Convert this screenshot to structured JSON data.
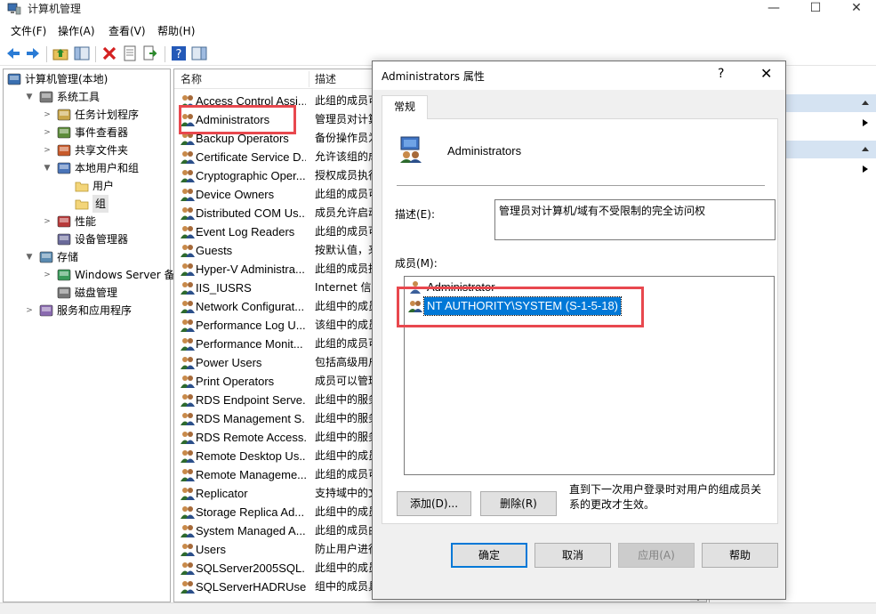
{
  "window": {
    "title": "计算机管理",
    "min": "—",
    "max": "☐",
    "close": "✕"
  },
  "menu": [
    {
      "label": "文件(F)"
    },
    {
      "label": "操作(A)"
    },
    {
      "label": "查看(V)"
    },
    {
      "label": "帮助(H)"
    }
  ],
  "tree": [
    {
      "label": "计算机管理(本地)",
      "expander": "",
      "icon": "computer-management-icon",
      "level": 0
    },
    {
      "label": "系统工具",
      "expander": "▼",
      "icon": "system-tools-icon",
      "level": 1
    },
    {
      "label": "任务计划程序",
      "expander": ">",
      "icon": "task-scheduler-icon",
      "level": 2
    },
    {
      "label": "事件查看器",
      "expander": ">",
      "icon": "event-viewer-icon",
      "level": 2
    },
    {
      "label": "共享文件夹",
      "expander": ">",
      "icon": "shared-folders-icon",
      "level": 2
    },
    {
      "label": "本地用户和组",
      "expander": "▼",
      "icon": "local-users-groups-icon",
      "level": 2
    },
    {
      "label": "用户",
      "expander": "",
      "icon": "folder-icon",
      "level": 3
    },
    {
      "label": "组",
      "expander": "",
      "icon": "folder-icon",
      "level": 3,
      "selected": true
    },
    {
      "label": "性能",
      "expander": ">",
      "icon": "performance-icon",
      "level": 2
    },
    {
      "label": "设备管理器",
      "expander": "",
      "icon": "device-manager-icon",
      "level": 2
    },
    {
      "label": "存储",
      "expander": "▼",
      "icon": "storage-icon",
      "level": 1
    },
    {
      "label": "Windows Server 备份",
      "expander": ">",
      "icon": "windows-backup-icon",
      "level": 2
    },
    {
      "label": "磁盘管理",
      "expander": "",
      "icon": "disk-management-icon",
      "level": 2
    },
    {
      "label": "服务和应用程序",
      "expander": ">",
      "icon": "services-apps-icon",
      "level": 1
    }
  ],
  "list": {
    "columns": {
      "name": "名称",
      "description": "描述"
    },
    "rows": [
      {
        "name": "Access Control Assi...",
        "description": "此组的成员可"
      },
      {
        "name": "Administrators",
        "description": "管理员对计算"
      },
      {
        "name": "Backup Operators",
        "description": "备份操作员为"
      },
      {
        "name": "Certificate Service D...",
        "description": "允许该组的成"
      },
      {
        "name": "Cryptographic Oper...",
        "description": "授权成员执行"
      },
      {
        "name": "Device Owners",
        "description": "此组的成员可"
      },
      {
        "name": "Distributed COM Us...",
        "description": "成员允许启动"
      },
      {
        "name": "Event Log Readers",
        "description": "此组的成员可"
      },
      {
        "name": "Guests",
        "description": "按默认值，来"
      },
      {
        "name": "Hyper-V Administra...",
        "description": "此组的成员拥"
      },
      {
        "name": "IIS_IUSRS",
        "description": "Internet 信息"
      },
      {
        "name": "Network Configurat...",
        "description": "此组中的成员"
      },
      {
        "name": "Performance Log U...",
        "description": "该组中的成员"
      },
      {
        "name": "Performance Monit...",
        "description": "此组的成员可"
      },
      {
        "name": "Power Users",
        "description": "包括高级用户"
      },
      {
        "name": "Print Operators",
        "description": "成员可以管理"
      },
      {
        "name": "RDS Endpoint Serve...",
        "description": "此组中的服务"
      },
      {
        "name": "RDS Management S...",
        "description": "此组中的服务"
      },
      {
        "name": "RDS Remote Access...",
        "description": "此组中的服务"
      },
      {
        "name": "Remote Desktop Us...",
        "description": "此组中的成员"
      },
      {
        "name": "Remote Manageme...",
        "description": "此组的成员可"
      },
      {
        "name": "Replicator",
        "description": "支持域中的文"
      },
      {
        "name": "Storage Replica Ad...",
        "description": "此组中的成员"
      },
      {
        "name": "System Managed A...",
        "description": "此组的成员由"
      },
      {
        "name": "Users",
        "description": "防止用户进行"
      },
      {
        "name": "SQLServer2005SQL...",
        "description": "此组中的成员"
      },
      {
        "name": "SQLServerHADRUse...",
        "description": "组中的成员具有所需的权限，可..."
      }
    ]
  },
  "dialog": {
    "title": "Administrators 属性",
    "help": "?",
    "close": "✕",
    "tab": "常规",
    "group_name": "Administrators",
    "desc_label": "描述(E):",
    "desc_value": "管理员对计算机/域有不受限制的完全访问权",
    "members_label": "成员(M):",
    "members": [
      {
        "name": "Administrator",
        "selected": false
      },
      {
        "name": "NT AUTHORITY\\SYSTEM (S-1-5-18)",
        "selected": true
      }
    ],
    "add_button": "添加(D)...",
    "remove_button": "删除(R)",
    "note": "直到下一次用户登录时对用户的组成员关系的更改才生效。",
    "ok": "确定",
    "cancel": "取消",
    "apply": "应用(A)",
    "help_button": "帮助"
  },
  "colors": {
    "highlight_box": "#e8484e",
    "selection": "#0078d7",
    "action_header": "#d5e3f2"
  }
}
